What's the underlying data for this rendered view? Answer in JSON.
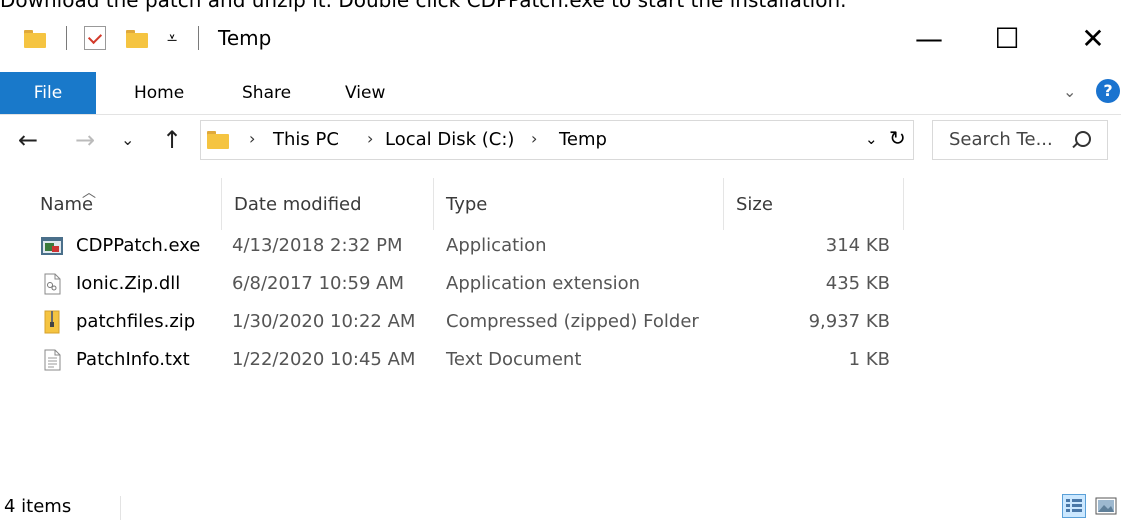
{
  "caption": "Download the patch and unzip it.  Double click CDPPatch.exe to start the installation.",
  "window": {
    "title": "Temp",
    "controls": {
      "minimize": "—",
      "maximize": "☐",
      "close": "✕"
    }
  },
  "ribbon": {
    "tabs": [
      "File",
      "Home",
      "Share",
      "View"
    ],
    "collapse_chevron": "⌄",
    "help": "?"
  },
  "nav": {
    "back": "←",
    "forward": "→",
    "recent": "⌄",
    "up": "↑",
    "breadcrumb": [
      "This PC",
      "Local Disk (C:)",
      "Temp"
    ],
    "separator": "›",
    "dropdown": "⌄",
    "refresh": "↻",
    "search_placeholder": "Search Te..."
  },
  "columns": [
    "Name",
    "Date modified",
    "Type",
    "Size"
  ],
  "files": [
    {
      "name": "CDPPatch.exe",
      "date": "4/13/2018 2:32 PM",
      "type": "Application",
      "size": "314 KB",
      "icon": "exe-icon"
    },
    {
      "name": "Ionic.Zip.dll",
      "date": "6/8/2017 10:59 AM",
      "type": "Application extension",
      "size": "435 KB",
      "icon": "dll-icon"
    },
    {
      "name": "patchfiles.zip",
      "date": "1/30/2020 10:22 AM",
      "type": "Compressed (zipped) Folder",
      "size": "9,937 KB",
      "icon": "zip-folder-icon"
    },
    {
      "name": "PatchInfo.txt",
      "date": "1/22/2020 10:45 AM",
      "type": "Text Document",
      "size": "1 KB",
      "icon": "text-file-icon"
    }
  ],
  "status": {
    "item_count": "4 items"
  },
  "colors": {
    "accent": "#1979ca",
    "folder": "#f5c441",
    "selection": "#cce8ff"
  }
}
